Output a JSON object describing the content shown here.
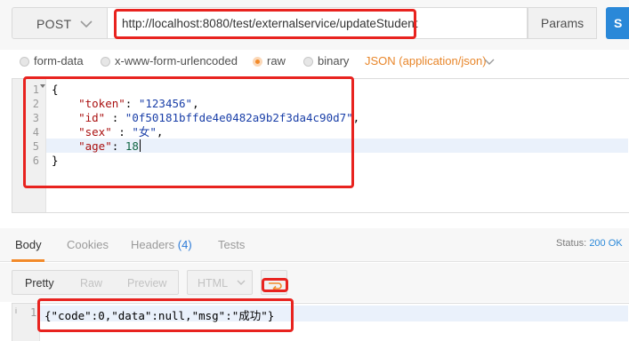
{
  "request": {
    "method": "POST",
    "url": "http://localhost:8080/test/externalservice/updateStudent",
    "params_label": "Params",
    "send_label": "S"
  },
  "body_types": {
    "options": [
      "form-data",
      "x-www-form-urlencoded",
      "raw",
      "binary"
    ],
    "selected": "raw",
    "content_type": "JSON (application/json)"
  },
  "editor": {
    "line_numbers": [
      "1",
      "2",
      "3",
      "4",
      "5",
      "6"
    ],
    "lines": [
      {
        "text": "{"
      },
      {
        "key": "\"token\"",
        "sep": ": ",
        "value": "\"123456\"",
        "tail": ","
      },
      {
        "key": "\"id\"",
        "sep": " : ",
        "value": "\"0f50181bffde4e0482a9b2f3da4c90d7\"",
        "tail": ","
      },
      {
        "key": "\"sex\"",
        "sep": " : ",
        "value": "\"女\"",
        "tail": ","
      },
      {
        "key": "\"age\"",
        "sep": ": ",
        "value": "18",
        "tail": ""
      },
      {
        "text": "}"
      }
    ]
  },
  "response": {
    "tabs": [
      "Body",
      "Cookies",
      "Headers",
      "Tests"
    ],
    "headers_count": "(4)",
    "active_tab": "Body",
    "status_label": "Status:",
    "status_value": "200 OK",
    "formats": [
      "Pretty",
      "Raw",
      "Preview"
    ],
    "language": "HTML",
    "line_number": "1",
    "gutter_marker": "i",
    "body": "{\"code\":0,\"data\":null,\"msg\":\"成功\"}"
  },
  "colors": {
    "accent": "#f28a2a",
    "send_button": "#2a88d8",
    "annotation": "#e8231f"
  }
}
